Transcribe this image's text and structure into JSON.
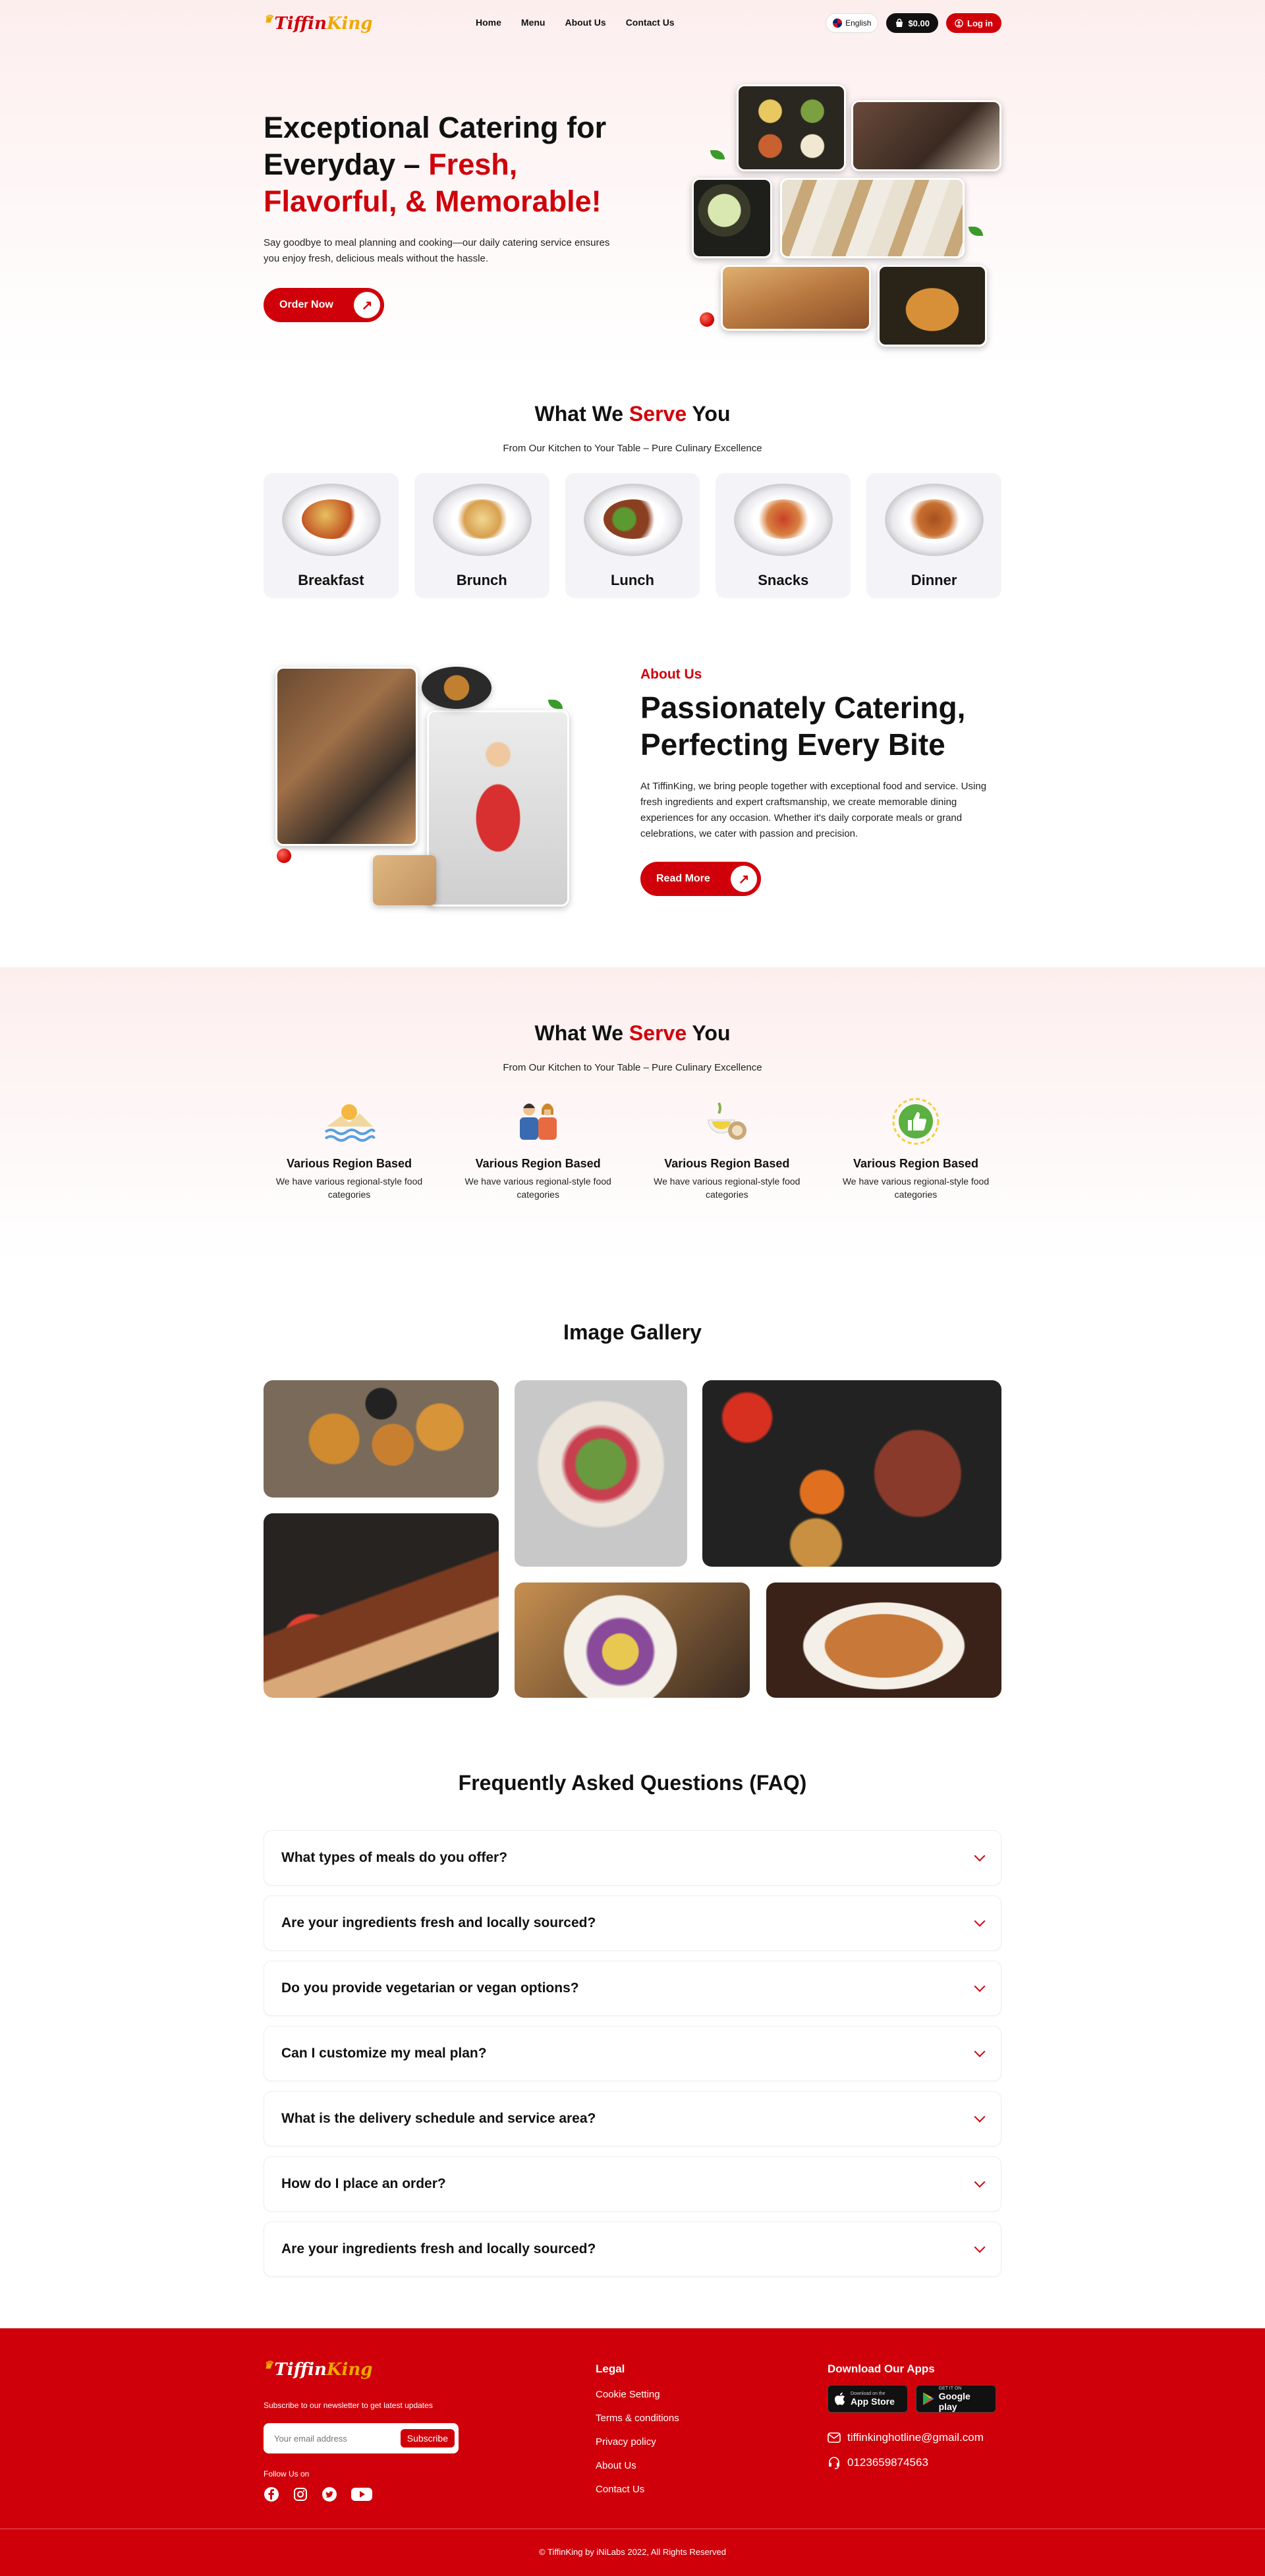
{
  "header": {
    "logo_part1": "Tiffin",
    "logo_part2": "King",
    "nav": [
      "Home",
      "Menu",
      "About Us",
      "Contact Us"
    ],
    "language": "English",
    "cart_total": "$0.00",
    "login_label": "Log in"
  },
  "hero": {
    "title_part1": "Exceptional Catering for Everyday – ",
    "title_highlight": "Fresh, Flavorful, & Memorable!",
    "description": "Say goodbye to meal planning and cooking—our daily catering service ensures you enjoy fresh, delicious meals without the hassle.",
    "cta_label": "Order Now"
  },
  "serve": {
    "title_part1": "What We ",
    "title_highlight": "Serve",
    "title_part2": " You",
    "subtitle": "From Our Kitchen to Your Table – Pure Culinary Excellence",
    "categories": [
      "Breakfast",
      "Brunch",
      "Lunch",
      "Snacks",
      "Dinner"
    ]
  },
  "about": {
    "subtitle": "About Us",
    "title": "Passionately Catering, Perfecting Every Bite",
    "description": "At TiffinKing, we bring people together with exceptional food and service. Using fresh ingredients and expert craftsmanship, we create memorable dining experiences for any occasion. Whether it's daily corporate meals or grand celebrations, we cater with passion and precision.",
    "cta_label": "Read More"
  },
  "features": {
    "title_part1": "What We ",
    "title_highlight": "Serve",
    "title_part2": " You",
    "subtitle": "From Our Kitchen to Your Table – Pure Culinary Excellence",
    "items": [
      {
        "title": "Various Region Based",
        "desc": "We have various regional-style food categories"
      },
      {
        "title": "Various Region Based",
        "desc": "We have various regional-style food categories"
      },
      {
        "title": "Various Region Based",
        "desc": "We have various regional-style food categories"
      },
      {
        "title": "Various Region Based",
        "desc": "We have various regional-style food categories"
      }
    ]
  },
  "gallery": {
    "title": "Image Gallery"
  },
  "faq": {
    "title": "Frequently Asked Questions (FAQ)",
    "questions": [
      "What types of meals do you offer?",
      "Are your ingredients fresh and locally sourced?",
      "Do you provide vegetarian or vegan options?",
      "Can I customize my meal plan?",
      "What is the delivery schedule and service area?",
      "How do I place an order?",
      "Are your ingredients fresh and locally sourced?"
    ]
  },
  "footer": {
    "logo_part1": "Tiffin",
    "logo_part2": "King",
    "newsletter_text": "Subscribe to our newsletter to get latest updates",
    "email_placeholder": "Your email address",
    "subscribe_label": "Subscribe",
    "follow_label": "Follow Us on",
    "legal_title": "Legal",
    "legal_links": [
      "Cookie Setting",
      "Terms & conditions",
      "Privacy policy",
      "About Us",
      "Contact Us"
    ],
    "apps_title": "Download Our Apps",
    "app_store_small": "Download on the",
    "app_store_label": "App Store",
    "google_play_small": "GET IT ON",
    "google_play_label": "Google play",
    "email": "tiffinkinghotline@gmail.com",
    "phone": "0123659874563",
    "copyright": "© TiffinKing by iNiLabs 2022, All Rights Reserved"
  },
  "colors": {
    "brand_red": "#d0000a",
    "brand_gold": "#f0a800"
  }
}
